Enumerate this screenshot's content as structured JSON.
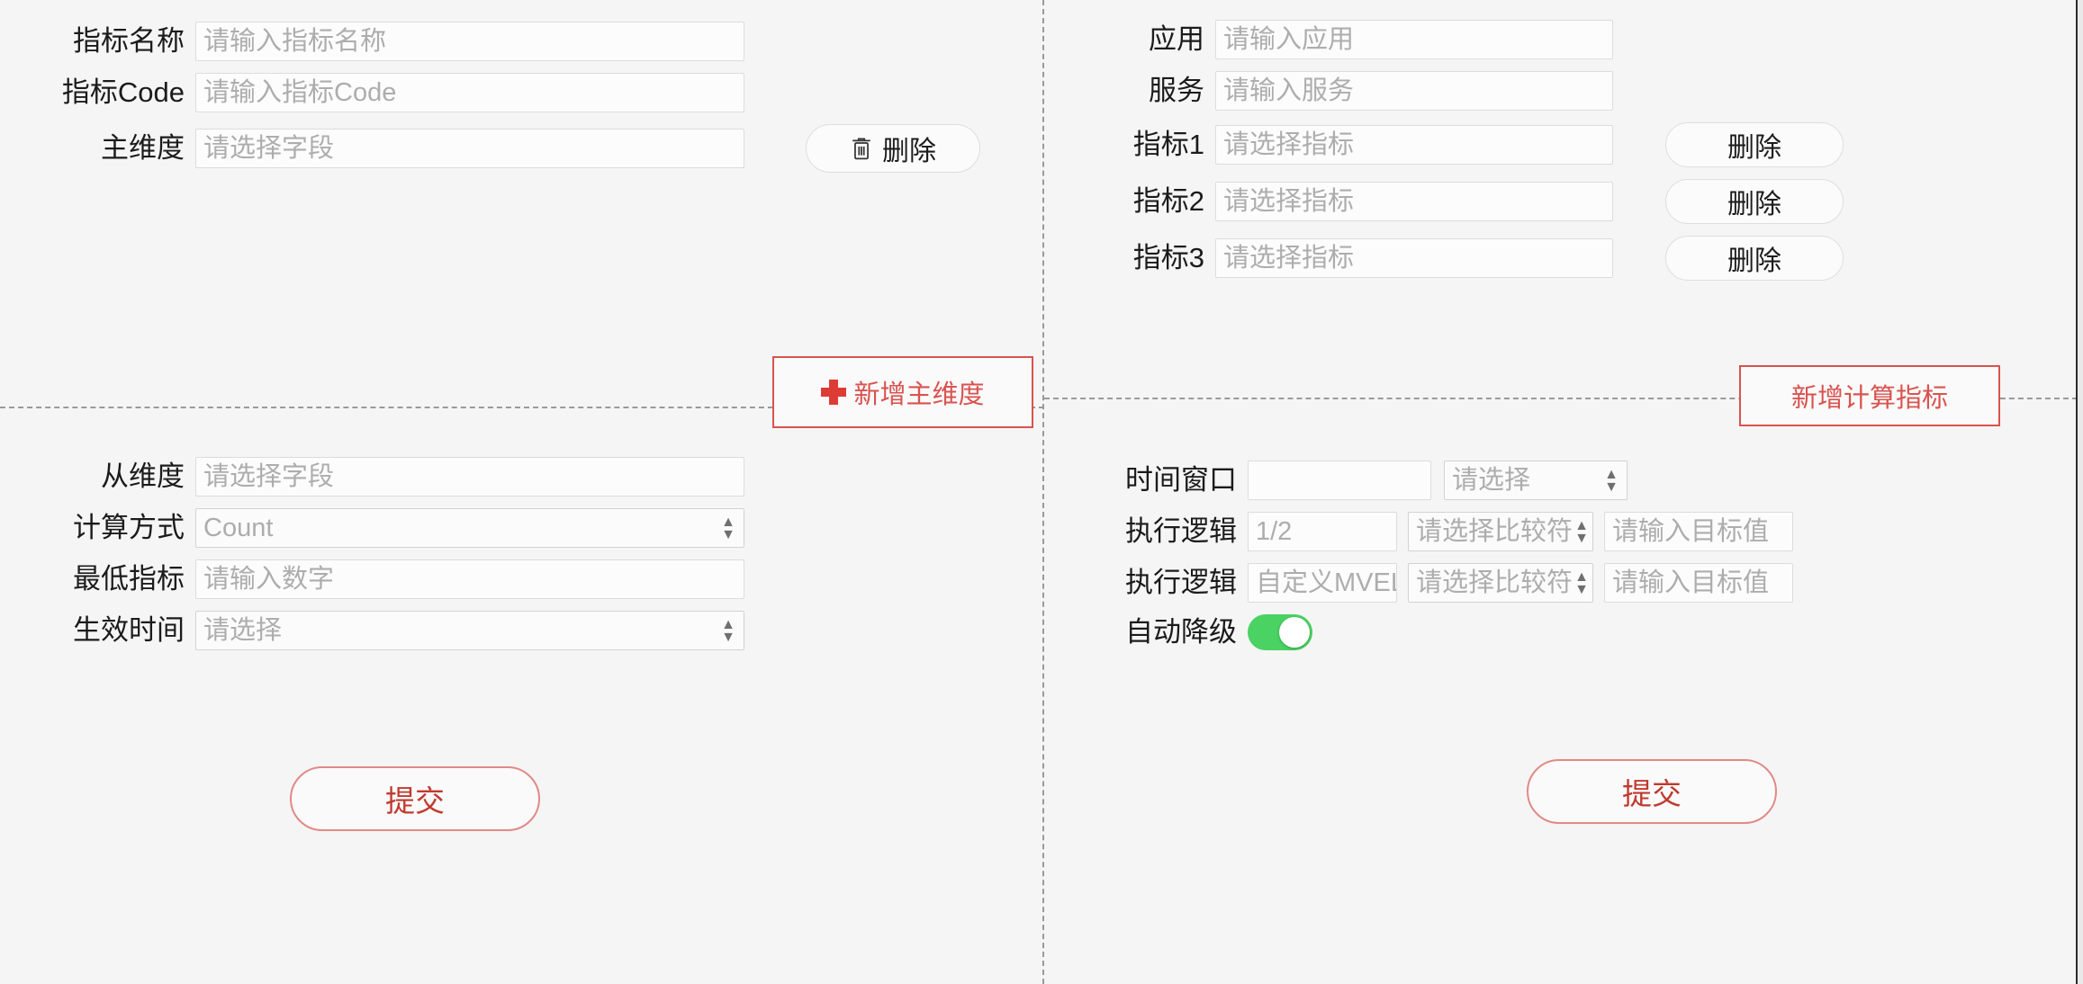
{
  "colors": {
    "background": "#f5f5f5",
    "accent_red": "#d9534f",
    "submit_red": "#c0392f",
    "toggle_on_green": "#4ad263",
    "divider_gray": "#9a9a9a",
    "field_border": "#dcdcdc",
    "placeholder_gray": "#adadad"
  },
  "panels": {
    "top_left": {
      "fields": [
        {
          "label": "指标名称",
          "placeholder": "请输入指标名称",
          "value": "",
          "type": "input"
        },
        {
          "label": "指标Code",
          "placeholder": "请输入指标Code",
          "value": "",
          "type": "input"
        },
        {
          "label": "主维度",
          "placeholder": "请选择字段",
          "value": "",
          "type": "input"
        }
      ],
      "delete_button": {
        "label": "删除",
        "icon": "trash-icon"
      },
      "add_button": {
        "label": "新增主维度",
        "icon": "plus-icon"
      }
    },
    "bottom_left": {
      "fields": [
        {
          "label": "从维度",
          "placeholder": "请选择字段",
          "value": "",
          "type": "input"
        },
        {
          "label": "计算方式",
          "placeholder": "",
          "value": "Count",
          "type": "select"
        },
        {
          "label": "最低指标",
          "placeholder": "请输入数字",
          "value": "",
          "type": "input"
        },
        {
          "label": "生效时间",
          "placeholder": "",
          "value": "请选择",
          "type": "select"
        }
      ],
      "submit_button": {
        "label": "提交"
      }
    },
    "top_right": {
      "fields": [
        {
          "label": "应用",
          "placeholder": "请输入应用",
          "value": "",
          "type": "input",
          "delete_label": ""
        },
        {
          "label": "服务",
          "placeholder": "请输入服务",
          "value": "",
          "type": "input",
          "delete_label": ""
        },
        {
          "label": "指标1",
          "placeholder": "请选择指标",
          "value": "",
          "type": "input",
          "delete_label": "删除"
        },
        {
          "label": "指标2",
          "placeholder": "请选择指标",
          "value": "",
          "type": "input",
          "delete_label": "删除"
        },
        {
          "label": "指标3",
          "placeholder": "请选择指标",
          "value": "",
          "type": "input",
          "delete_label": "删除"
        }
      ],
      "add_button": {
        "label": "新增计算指标"
      }
    },
    "bottom_right": {
      "time_window": {
        "label": "时间窗口",
        "amount_value": "",
        "amount_placeholder": "",
        "unit_value": "请选择"
      },
      "exec_logic_rows": [
        {
          "label": "执行逻辑",
          "expr_value": "1/2",
          "comparator_value": "请选择比较符",
          "target_value": "",
          "target_placeholder": "请输入目标值"
        },
        {
          "label": "执行逻辑",
          "expr_value": "自定义MVEL",
          "comparator_value": "请选择比较符",
          "target_value": "",
          "target_placeholder": "请输入目标值"
        }
      ],
      "auto_degrade": {
        "label": "自动降级",
        "state": "on"
      },
      "submit_button": {
        "label": "提交"
      }
    }
  }
}
